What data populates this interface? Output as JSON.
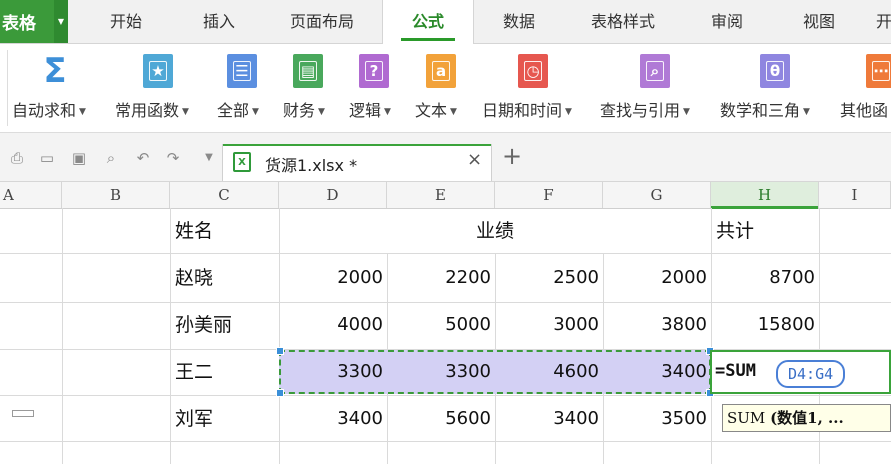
{
  "menubar": {
    "app_label": "表格",
    "tabs": [
      {
        "label": "开始"
      },
      {
        "label": "插入"
      },
      {
        "label": "页面布局"
      },
      {
        "label": "公式"
      },
      {
        "label": "数据"
      },
      {
        "label": "表格样式"
      },
      {
        "label": "审阅"
      },
      {
        "label": "视图"
      },
      {
        "label": "开"
      }
    ],
    "active_tab": "公式"
  },
  "ribbon": {
    "groups": [
      {
        "label": "自动求和",
        "icon": "sigma-icon",
        "glyph": "Σ",
        "color": "#3d8fd8"
      },
      {
        "label": "常用函数",
        "icon": "star-function-icon",
        "glyph": "★",
        "color": "#4fa8d6"
      },
      {
        "label": "全部",
        "icon": "list-function-icon",
        "glyph": "☰",
        "color": "#5b8fe0"
      },
      {
        "label": "财务",
        "icon": "finance-function-icon",
        "glyph": "▤",
        "color": "#49a85c"
      },
      {
        "label": "逻辑",
        "icon": "logic-function-icon",
        "glyph": "?",
        "color": "#b06ad1"
      },
      {
        "label": "文本",
        "icon": "text-function-icon",
        "glyph": "a",
        "color": "#f2a23a"
      },
      {
        "label": "日期和时间",
        "icon": "clock-function-icon",
        "glyph": "◷",
        "color": "#e6574f"
      },
      {
        "label": "查找与引用",
        "icon": "lookup-function-icon",
        "glyph": "⌕",
        "color": "#b07ad6"
      },
      {
        "label": "数学和三角",
        "icon": "math-function-icon",
        "glyph": "θ",
        "color": "#8f86e0"
      },
      {
        "label": "其他函",
        "icon": "other-function-icon",
        "glyph": "⋯",
        "color": "#ef7a3a"
      }
    ]
  },
  "document": {
    "filename": "货源1.xlsx *",
    "close_glyph": "×",
    "new_tab_glyph": "+"
  },
  "sheet": {
    "columns": [
      "A",
      "B",
      "C",
      "D",
      "E",
      "F",
      "G",
      "H",
      "I"
    ],
    "selected_column": "H",
    "header_row": {
      "name": "姓名",
      "performance": "业绩",
      "total": "共计"
    },
    "rows": [
      {
        "name": "赵晓",
        "d": "2000",
        "e": "2200",
        "f": "2500",
        "g": "2000",
        "h": "8700"
      },
      {
        "name": "孙美丽",
        "d": "4000",
        "e": "5000",
        "f": "3000",
        "g": "3800",
        "h": "15800"
      },
      {
        "name": "王二",
        "d": "3300",
        "e": "3300",
        "f": "4600",
        "g": "3400",
        "h": ""
      },
      {
        "name": "刘军",
        "d": "3400",
        "e": "5600",
        "f": "3400",
        "g": "3500",
        "h": ""
      }
    ],
    "formula_prefix": "=SUM",
    "formula_ref": "D4:G4",
    "tooltip_func": "SUM",
    "tooltip_args": "(数值1, ..."
  }
}
